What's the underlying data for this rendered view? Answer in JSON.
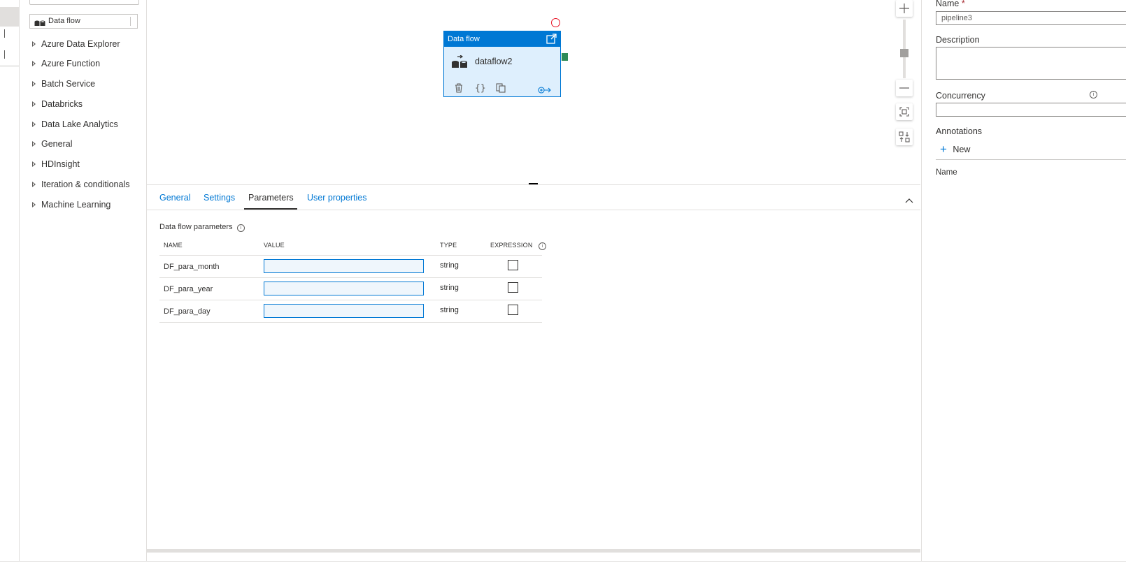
{
  "activities": {
    "current_item": "Data flow",
    "categories": [
      "Azure Data Explorer",
      "Azure Function",
      "Batch Service",
      "Databricks",
      "Data Lake Analytics",
      "General",
      "HDInsight",
      "Iteration & conditionals",
      "Machine Learning"
    ]
  },
  "canvas": {
    "node": {
      "type_label": "Data flow",
      "name": "dataflow2"
    }
  },
  "properties": {
    "tabs": [
      "General",
      "Settings",
      "Parameters",
      "User properties"
    ],
    "active_tab": "Parameters",
    "section_title": "Data flow parameters",
    "columns": {
      "name": "NAME",
      "value": "VALUE",
      "type": "TYPE",
      "expression": "EXPRESSION"
    },
    "rows": [
      {
        "name": "DF_para_month",
        "value": "",
        "type": "string",
        "expression": false
      },
      {
        "name": "DF_para_year",
        "value": "",
        "type": "string",
        "expression": false
      },
      {
        "name": "DF_para_day",
        "value": "",
        "type": "string",
        "expression": false
      }
    ]
  },
  "pipeline": {
    "name_label": "Name",
    "required_mark": "*",
    "name_value": "pipeline3",
    "description_label": "Description",
    "concurrency_label": "Concurrency",
    "annotations_label": "Annotations",
    "new_label": "New",
    "annotations_column": "Name"
  },
  "colors": {
    "accent": "#0078d4",
    "error": "#e81123",
    "success_port": "#2e8b57"
  }
}
